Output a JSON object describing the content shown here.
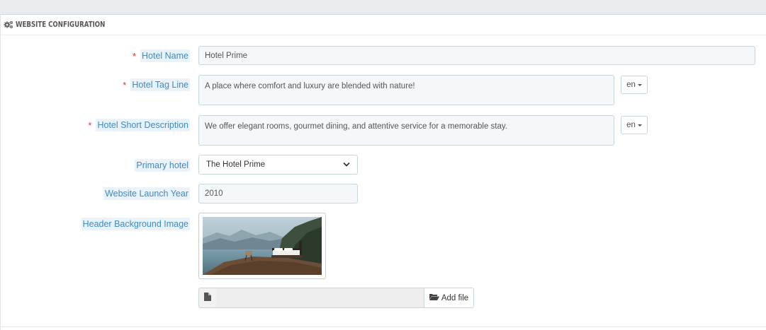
{
  "panel": {
    "title": "WEBSITE CONFIGURATION",
    "icon": "cogs-icon"
  },
  "form": {
    "required_mark": "*",
    "hotel_name": {
      "label": "Hotel Name",
      "value": "Hotel Prime",
      "required": true
    },
    "tag_line": {
      "label": "Hotel Tag Line",
      "value": "A place where comfort and luxury are blended with nature!",
      "required": true,
      "lang": "en"
    },
    "short_description": {
      "label": "Hotel Short Description",
      "value": "We offer elegant rooms, gourmet dining, and attentive service for a memorable stay.",
      "required": true,
      "lang": "en"
    },
    "primary_hotel": {
      "label": "Primary hotel",
      "selected": "The Hotel Prime"
    },
    "launch_year": {
      "label": "Website Launch Year",
      "value": "2010"
    },
    "header_image": {
      "label": "Header Background Image"
    },
    "file_upload": {
      "add_label": "Add file",
      "file_icon": "file-icon",
      "folder_icon": "folder-open-icon"
    }
  },
  "colors": {
    "label_text": "#3f8ac4",
    "label_bg": "#eaf3fa",
    "required": "#e0312f",
    "input_bg": "#f4f8fb",
    "input_border": "#c7d6db"
  }
}
